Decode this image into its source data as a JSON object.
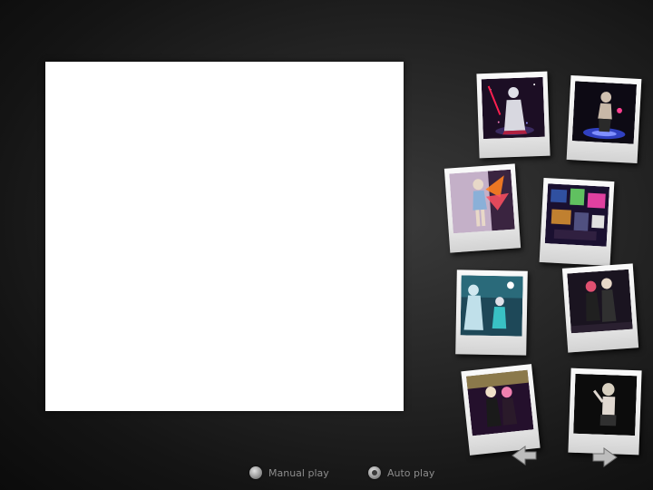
{
  "viewer": {
    "background": "#ffffff"
  },
  "thumbnails": [
    {
      "name": "thumb-1",
      "bg": "#2a1530",
      "accent": "#d8d8e0",
      "glow": "#ff2050"
    },
    {
      "name": "thumb-2",
      "bg": "#0d0a14",
      "accent": "#c8b8a8",
      "glow": "#6060ff"
    },
    {
      "name": "thumb-3",
      "bg": "#c4b0c8",
      "accent": "#8ab0d8",
      "glow": "#ff8020"
    },
    {
      "name": "thumb-4",
      "bg": "#1a1030",
      "accent": "#60c060",
      "glow": "#e040a0"
    },
    {
      "name": "thumb-5",
      "bg": "#205060",
      "accent": "#d0e8f0",
      "glow": "#40e0e0"
    },
    {
      "name": "thumb-6",
      "bg": "#1a1420",
      "accent": "#e05070",
      "glow": "#505050"
    },
    {
      "name": "thumb-7",
      "bg": "#24102c",
      "accent": "#f080b0",
      "glow": "#d0c060"
    },
    {
      "name": "thumb-8",
      "bg": "#0c0c0c",
      "accent": "#d8d0c0",
      "glow": "#303030"
    }
  ],
  "play_controls": {
    "manual_label": "Manual play",
    "auto_label": "Auto play",
    "selected": "auto"
  }
}
